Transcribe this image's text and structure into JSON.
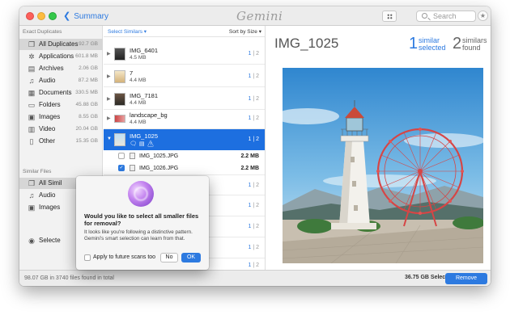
{
  "window": {
    "back_label": "Summary",
    "app_title": "Gemini",
    "search_placeholder": "Search"
  },
  "sidebar": {
    "exact_title": "Exact Duplicates",
    "exact_items": [
      {
        "label": "All Duplicates",
        "size": "92.7 GB",
        "icon": "copy-icon"
      },
      {
        "label": "Applications",
        "size": "601.8 MB",
        "icon": "apps-icon"
      },
      {
        "label": "Archives",
        "size": "2.06 GB",
        "icon": "archive-icon"
      },
      {
        "label": "Audio",
        "size": "87.2 MB",
        "icon": "music-icon"
      },
      {
        "label": "Documents",
        "size": "330.5 MB",
        "icon": "document-icon"
      },
      {
        "label": "Folders",
        "size": "45.88 GB",
        "icon": "folder-icon"
      },
      {
        "label": "Images",
        "size": "8.55 GB",
        "icon": "image-icon"
      },
      {
        "label": "Video",
        "size": "20.04 GB",
        "icon": "video-icon"
      },
      {
        "label": "Other",
        "size": "15.35 GB",
        "icon": "file-icon"
      }
    ],
    "similar_title": "Similar Files",
    "similar_items": [
      {
        "label": "All Simil",
        "icon": "copy-icon"
      },
      {
        "label": "Audio",
        "icon": "music-icon"
      },
      {
        "label": "Images",
        "icon": "image-icon"
      }
    ],
    "selected_label": "Selecte"
  },
  "list": {
    "select_similars": "Select Similars ▾",
    "sort_by": "Sort by Size ▾",
    "groups": [
      {
        "name": "IMG_6401",
        "size": "4.5 MB",
        "sel": "1",
        "total": "2"
      },
      {
        "name": "7",
        "size": "4.4 MB",
        "sel": "1",
        "total": "2"
      },
      {
        "name": "IMG_7181",
        "size": "4.4 MB",
        "sel": "1",
        "total": "2"
      },
      {
        "name": "landscape_bg",
        "size": "4.4 MB",
        "sel": "1",
        "total": "2"
      },
      {
        "name": "IMG_1025",
        "size": "",
        "sel": "1",
        "total": "2"
      }
    ],
    "files": [
      {
        "name": "IMG_1025.JPG",
        "size": "2.2 MB"
      },
      {
        "name": "IMG_1026.JPG",
        "size": "2.2 MB"
      }
    ],
    "lower_counts": [
      {
        "sel": "1",
        "total": "2"
      },
      {
        "sel": "1",
        "total": "2"
      },
      {
        "sel": "1",
        "total": "2"
      },
      {
        "sel": "1",
        "total": "2"
      },
      {
        "sel": "1",
        "total": "2"
      }
    ]
  },
  "detail": {
    "title": "IMG_1025",
    "similar_count": "1",
    "similar_label_1": "similar",
    "similar_label_2": "selected",
    "found_count": "2",
    "found_label_1": "similars",
    "found_label_2": "found"
  },
  "dialog": {
    "question": "Would you like to select all smaller files for removal?",
    "description": "It looks like you're following a distinctive pattern. Gemini's smart selection can learn from that.",
    "checkbox_label": "Apply to future scans too",
    "no_label": "No",
    "ok_label": "OK"
  },
  "footer": {
    "summary": "98.07 GB in 3740 files found in total",
    "selected": "36.75 GB Selected",
    "remove_label": "Remove"
  },
  "colors": {
    "accent": "#2d7ae0",
    "selection": "#1d6fe0"
  }
}
